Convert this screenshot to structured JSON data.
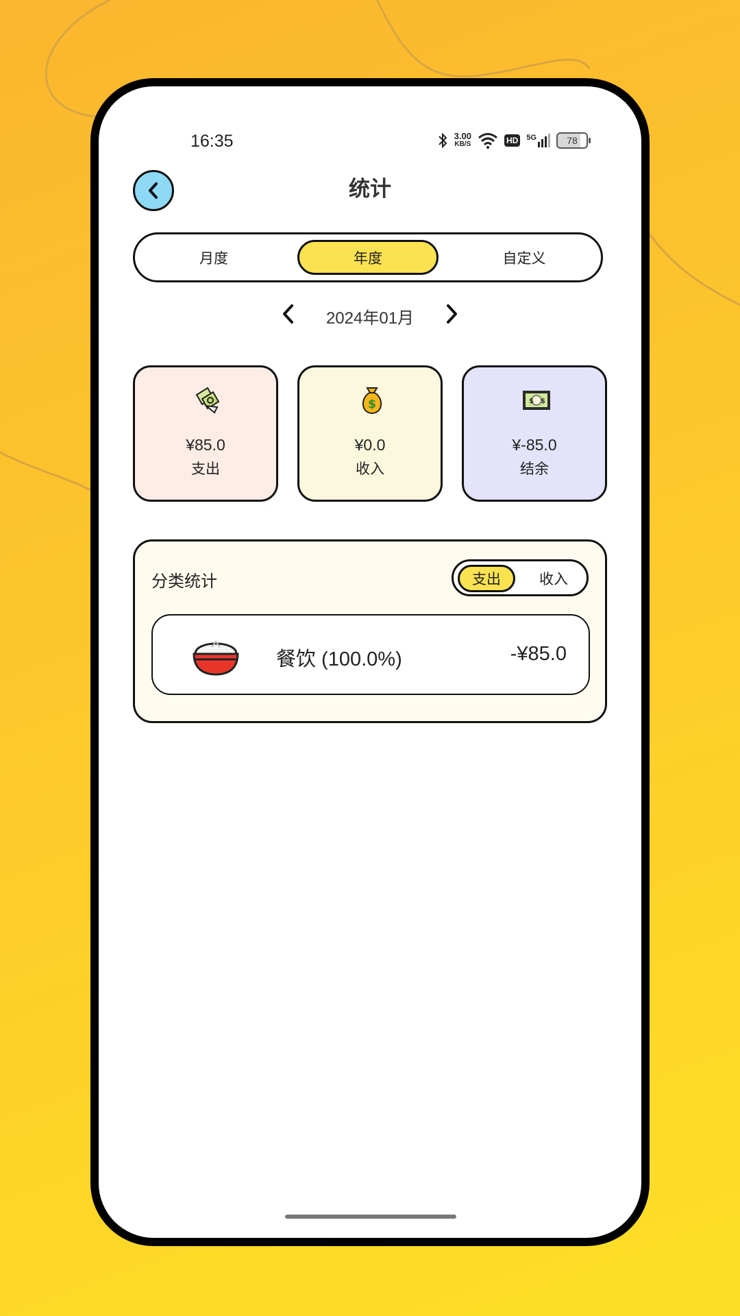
{
  "status_bar": {
    "time": "16:35",
    "network_speed_value": "3.00",
    "network_speed_unit": "KB/S",
    "hd_label": "HD",
    "signal_label": "5G",
    "battery_level": "78",
    "icons": [
      "bluetooth-icon",
      "wifi-icon",
      "hd-icon",
      "signal-5g-icon",
      "battery-icon"
    ]
  },
  "header": {
    "title": "统计",
    "back_icon": "chevron-left-icon"
  },
  "period_tabs": {
    "monthly": "月度",
    "yearly": "年度",
    "custom": "自定义",
    "selected": "年度"
  },
  "date_nav": {
    "label": "2024年01月",
    "prev_icon": "chevron-left-icon",
    "next_icon": "chevron-right-icon"
  },
  "summary": {
    "expense": {
      "amount": "¥85.0",
      "label": "支出",
      "icon": "money-wings-icon",
      "bg": "#feede6"
    },
    "income": {
      "amount": "¥0.0",
      "label": "收入",
      "icon": "money-bag-icon",
      "bg": "#fbf8dd"
    },
    "balance": {
      "amount": "¥-85.0",
      "label": "结余",
      "icon": "banknote-icon",
      "bg": "#e3e3fc"
    }
  },
  "category_stats": {
    "title": "分类统计",
    "toggle_expense": "支出",
    "toggle_income": "收入",
    "selected": "支出",
    "items": [
      {
        "name": "餐饮 (100.0%)",
        "amount": "-¥85.0",
        "icon": "rice-bowl-icon"
      }
    ]
  },
  "colors": {
    "accent_yellow": "#fbe251",
    "back_button": "#8dd9f6",
    "panel_bg": "#fffcef"
  }
}
